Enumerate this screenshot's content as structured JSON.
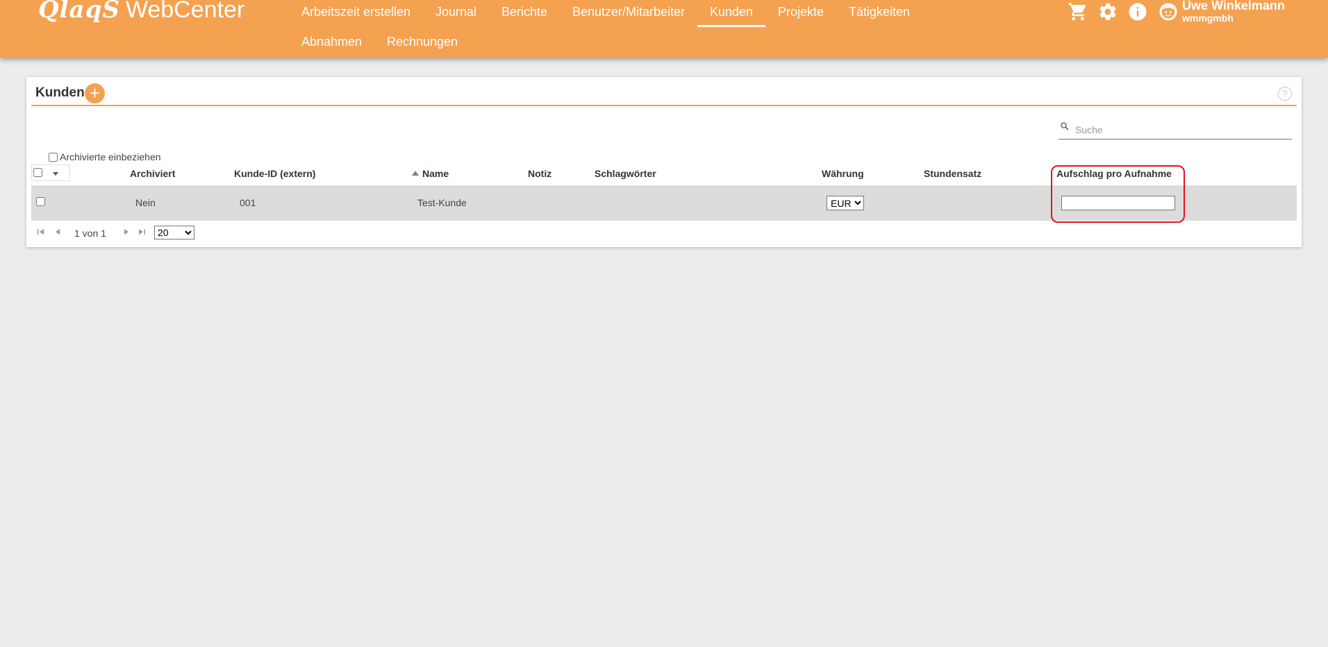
{
  "header": {
    "logo_brand": "QlaqS",
    "logo_product": "WebCenter",
    "nav": [
      {
        "label": "Arbeitszeit erstellen"
      },
      {
        "label": "Journal"
      },
      {
        "label": "Berichte"
      },
      {
        "label": "Benutzer/Mitarbeiter"
      },
      {
        "label": "Kunden",
        "active": true
      },
      {
        "label": "Projekte"
      },
      {
        "label": "Tätigkeiten"
      },
      {
        "label": "Abnahmen"
      },
      {
        "label": "Rechnungen"
      }
    ],
    "icons": [
      "cart-icon",
      "gear-icon",
      "info-icon",
      "user-avatar-icon"
    ],
    "user": {
      "name": "Uwe Winkelmann",
      "org": "wmmgmbh"
    },
    "accent_color": "#f4a150"
  },
  "card": {
    "title": "Kunden",
    "add_label": "+",
    "help_label": "?",
    "search": {
      "placeholder": "Suche",
      "value": ""
    },
    "archived_filter_label": "Archivierte einbeziehen",
    "table": {
      "columns": {
        "archiviert": "Archiviert",
        "kunde_id": "Kunde-ID (extern)",
        "name": "Name",
        "notiz": "Notiz",
        "schlagwoerter": "Schlagwörter",
        "waehrung": "Währung",
        "stundensatz": "Stundensatz",
        "aufschlag": "Aufschlag pro Aufnahme"
      },
      "sort": {
        "column": "Name",
        "direction": "ascending"
      },
      "rows": [
        {
          "archiviert": "Nein",
          "kunde_id": "001",
          "name": "Test-Kunde",
          "notiz": "",
          "schlagwoerter": "",
          "waehrung": "EUR",
          "stundensatz": "",
          "aufschlag": ""
        }
      ]
    },
    "pager": {
      "text": "1 von 1",
      "page_size": "20"
    },
    "highlight_color": "#e0141e"
  }
}
